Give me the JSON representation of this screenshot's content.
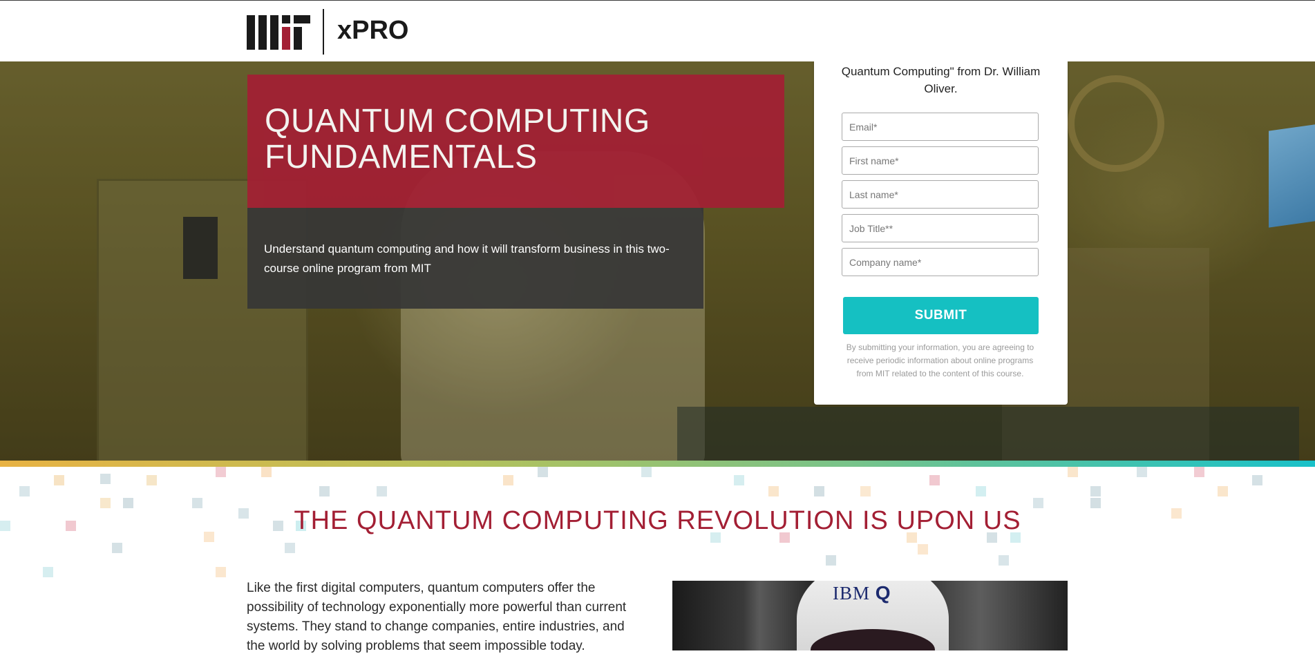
{
  "header": {
    "logo_text": "MIT",
    "brand": "xPRO"
  },
  "hero": {
    "title": "QUANTUM COMPUTING FUNDAMENTALS",
    "subtitle": "Understand quantum computing and how it will transform business in this two-course online program from MIT"
  },
  "form": {
    "intro": "Exclusive content, \"Ten Questions on Quantum Computing\" from Dr. William Oliver.",
    "fields": {
      "email": "Email*",
      "first_name": "First name*",
      "last_name": "Last name*",
      "job_title": "Job Title**",
      "company": "Company name*"
    },
    "submit_label": "SUBMIT",
    "disclaimer": "By submitting your information, you are agreeing to receive periodic information about online programs from MIT related to the content of this course."
  },
  "section": {
    "title": "THE QUANTUM COMPUTING REVOLUTION IS UPON US",
    "body": "Like the first digital computers, quantum computers offer the possibility of technology exponentially more powerful than current systems. They stand to change companies, entire industries, and the world by solving problems that seem impossible today.",
    "image_label_ibm": "IBM",
    "image_label_q": "Q"
  },
  "colors": {
    "mit_red": "#a31f34",
    "teal": "#15c0c2"
  }
}
